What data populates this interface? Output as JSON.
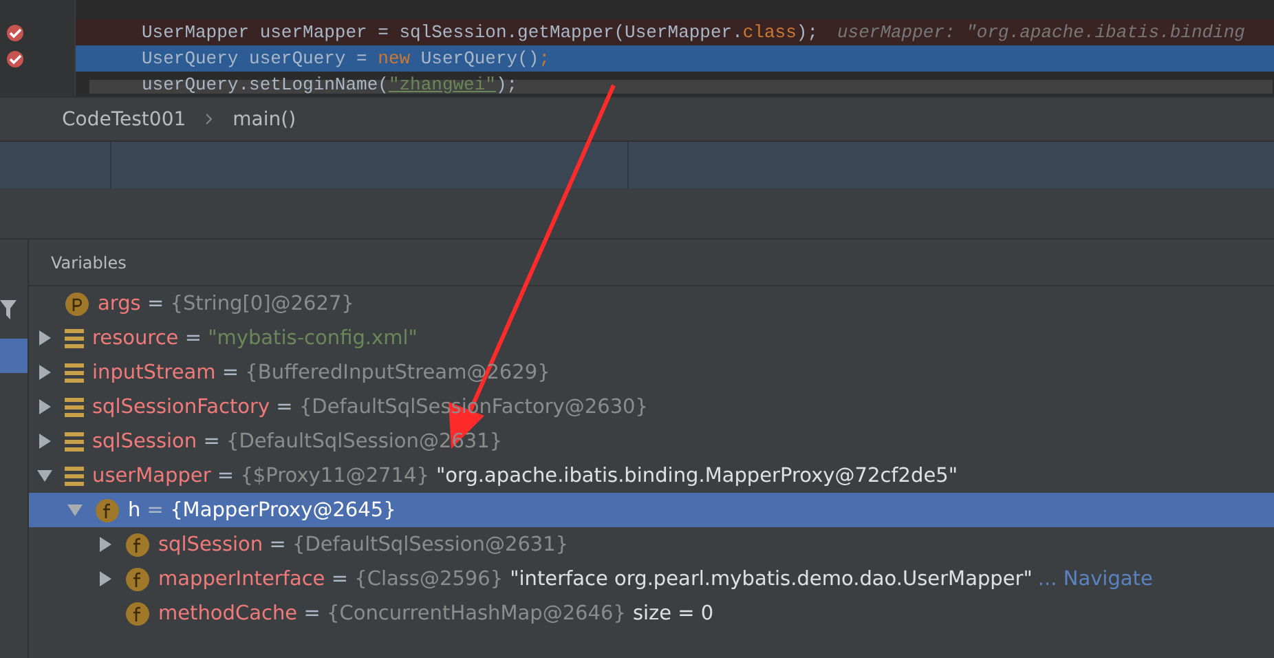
{
  "editor": {
    "lines": [
      {
        "breakpoint": true,
        "selected": false,
        "segments": [
          {
            "kind": "plain",
            "text": "UserMapper userMapper = sqlSession.getMapper(UserMapper."
          },
          {
            "kind": "keyword",
            "text": "class"
          },
          {
            "kind": "plain",
            "text": ");"
          },
          {
            "kind": "hint",
            "text": "userMapper: \"org.apache.ibatis.binding"
          }
        ]
      },
      {
        "breakpoint": true,
        "selected": true,
        "segments": [
          {
            "kind": "plain",
            "text": "UserQuery userQuery = "
          },
          {
            "kind": "keyword",
            "text": "new "
          },
          {
            "kind": "plain",
            "text": "UserQuery()"
          },
          {
            "kind": "keyword",
            "text": ";"
          }
        ]
      },
      {
        "breakpoint": false,
        "selected": false,
        "segments": [
          {
            "kind": "plain",
            "text": "userQuery.setLoginName("
          },
          {
            "kind": "string",
            "text": "\"zhangwei\""
          },
          {
            "kind": "plain",
            "text": ");"
          }
        ]
      }
    ]
  },
  "breadcrumb": [
    "CodeTest001",
    "main()"
  ],
  "variables": {
    "title": "Variables",
    "items": [
      {
        "kind": "param",
        "name": "args",
        "sep": "=",
        "value": "{String[0]@2627}",
        "selected": false
      },
      {
        "kind": "local",
        "name": "resource",
        "sep": "=",
        "string": "\"mybatis-config.xml\"",
        "expanded": false,
        "selected": false
      },
      {
        "kind": "local",
        "name": "inputStream",
        "sep": "=",
        "value": "{BufferedInputStream@2629}",
        "expanded": false,
        "selected": false
      },
      {
        "kind": "local",
        "name": "sqlSessionFactory",
        "sep": "=",
        "value": "{DefaultSqlSessionFactory@2630}",
        "expanded": false,
        "selected": false
      },
      {
        "kind": "local",
        "name": "sqlSession",
        "sep": "=",
        "value": "{DefaultSqlSession@2631}",
        "expanded": false,
        "selected": false
      },
      {
        "kind": "local",
        "name": "userMapper",
        "sep": "=",
        "value": "{$Proxy11@2714}",
        "note": "\"org.apache.ibatis.binding.MapperProxy@72cf2de5\"",
        "expanded": true,
        "selected": false,
        "children": [
          {
            "kind": "field",
            "name": "h",
            "sep": "=",
            "value": "{MapperProxy@2645}",
            "expanded": true,
            "selected": true,
            "children": [
              {
                "kind": "field",
                "name": "sqlSession",
                "sep": "=",
                "value": "{DefaultSqlSession@2631}",
                "expanded": false,
                "selected": false
              },
              {
                "kind": "field",
                "name": "mapperInterface",
                "sep": "=",
                "value": "{Class@2596}",
                "note": "\"interface org.pearl.mybatis.demo.dao.UserMapper\"",
                "link": "... Navigate",
                "expanded": false,
                "selected": false
              },
              {
                "kind": "field",
                "name": "methodCache",
                "sep": "=",
                "value": "{ConcurrentHashMap@2646}",
                "note": "size = 0",
                "selected": false
              }
            ]
          }
        ]
      }
    ]
  },
  "annotations": [
    {
      "kind": "arrow",
      "color": "#ff2b2b"
    }
  ]
}
